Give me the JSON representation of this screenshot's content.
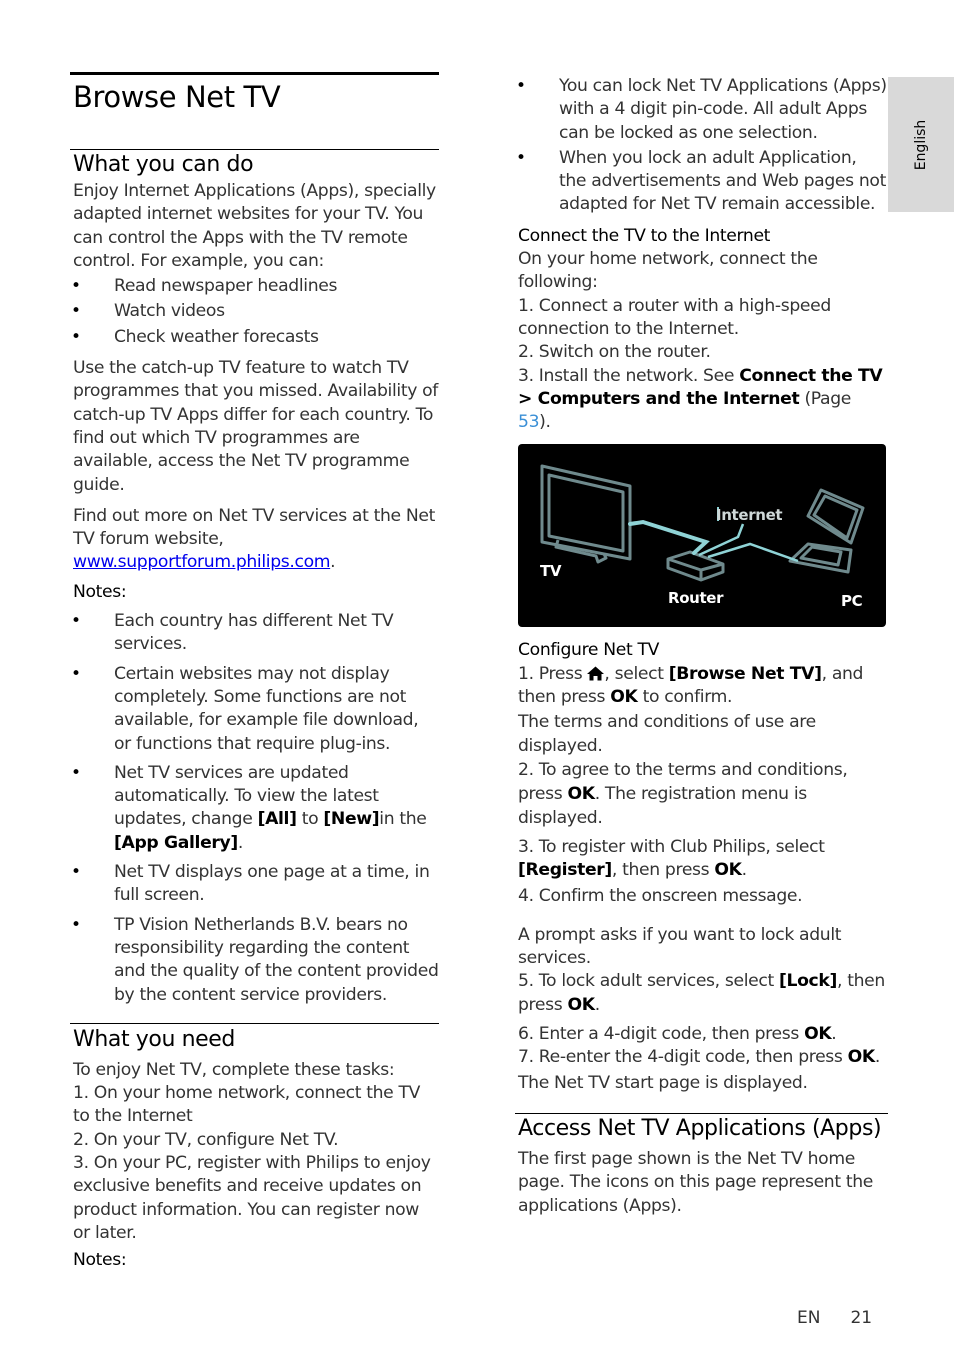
{
  "page": {
    "title": "Browse Net TV",
    "language_tab": "English",
    "footer": {
      "lang": "EN",
      "page_number": "21"
    }
  },
  "left": {
    "what_you_can_do": {
      "heading": "What you can do",
      "intro": "Enjoy Internet Applications (Apps), specially adapted internet websites for your TV. You can control the Apps with the TV remote control. For example, you can:",
      "examples": [
        "Read newspaper headlines",
        "Watch videos",
        "Check weather forecasts"
      ],
      "catchup": "Use the catch-up TV feature to watch TV programmes that you missed. Availability of catch-up TV Apps differ for each country. To find out which TV programmes are available, access the Net TV programme guide.",
      "forum_text": "Find out more on Net TV services at the Net TV forum website,",
      "forum_link": "www.supportforum.philips.com",
      "forum_end": ".",
      "notes_label": "Notes:",
      "notes": [
        "Each country has different Net TV services.",
        "Certain websites may not display completely. Some functions are not available, for example file download, or functions that require plug-ins."
      ],
      "note3": {
        "pre": "Net TV services are updated automatically. To view the latest updates, change ",
        "b1": "[All]",
        "mid": " to ",
        "b2": "[New]",
        "mid2": "in the ",
        "b3": "[App Gallery]",
        "post": "."
      },
      "notes_more": [
        "Net TV displays one page at a time, in full screen.",
        "TP Vision Netherlands B.V. bears no responsibility regarding the content and the quality of the content provided by the content service providers."
      ]
    },
    "what_you_need": {
      "heading": "What you need",
      "lines": [
        "To enjoy Net TV, complete these tasks:",
        "1. On your home network, connect the TV to the Internet",
        "2. On your TV, configure Net TV.",
        "3. On your PC, register with Philips to enjoy exclusive benefits and receive updates on product information. You can register now or later."
      ],
      "notes_label": "Notes:"
    }
  },
  "right": {
    "lock_notes": [
      "You can lock Net TV Applications (Apps) with a 4 digit pin-code. All adult Apps can be locked as one selection.",
      "When you lock an adult Application, the advertisements and Web pages not adapted for Net TV remain accessible."
    ],
    "connect": {
      "heading": "Connect the TV to the Internet",
      "lines": [
        "On your home network, connect the following:",
        "1. Connect a router with a high-speed connection to the Internet.",
        "2. Switch on the router."
      ],
      "step3_pre": "3. Install the network. See ",
      "step3_b1": "Connect the TV",
      "step3_b2": "> Computers and the Internet",
      "step3_mid": " (Page ",
      "step3_page": "53",
      "step3_post": ")."
    },
    "figure": {
      "labels": {
        "tv": "TV",
        "router": "Router",
        "internet": "Internet",
        "pc": "PC"
      },
      "colors": {
        "background": "#000000",
        "outline": "#6f8a8d",
        "cable": "#8fd3d6"
      }
    },
    "configure": {
      "heading": "Configure Net TV",
      "s1_pre": "1. Press ",
      "s1_icon": "home-icon",
      "s1_mid": ", select ",
      "s1_b": "[Browse Net TV]",
      "s1_mid2": ", and then press ",
      "s1_ok": "OK",
      "s1_post": " to confirm.",
      "s1_note": "The terms and conditions of use are displayed.",
      "s2_pre": "2. To agree to the terms and conditions, press ",
      "s2_ok": "OK",
      "s2_post": ". The registration menu is displayed.",
      "s3_pre": "3. To register with Club Philips, select ",
      "s3_b": "[Register]",
      "s3_mid": ", then press ",
      "s3_ok": "OK",
      "s3_post": ".",
      "s4": "4. Confirm the onscreen message.",
      "prompt": "A prompt asks if you want to lock adult services.",
      "s5_pre": "5. To lock adult services, select ",
      "s5_b": "[Lock]",
      "s5_mid": ", then press ",
      "s5_ok": "OK",
      "s5_post": ".",
      "s6_pre": "6. Enter a 4-digit code, then press ",
      "s6_ok": "OK",
      "s6_post": ".",
      "s7_pre": "7. Re-enter the 4-digit code, then press ",
      "s7_ok": "OK",
      "s7_post": ".",
      "s7_note": "The Net TV start page is displayed."
    },
    "access": {
      "heading": "Access Net TV Applications (Apps)",
      "text": "The first page shown is the Net TV home page. The icons on this page represent the applications (Apps)."
    }
  }
}
